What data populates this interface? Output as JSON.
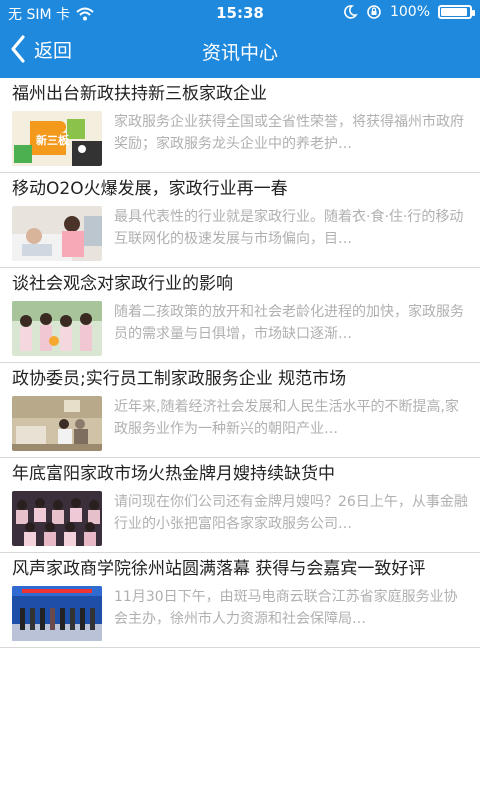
{
  "status_bar": {
    "carrier": "无 SIM 卡",
    "time": "15:38",
    "battery_text": "100%",
    "battery_level": 1.0
  },
  "nav": {
    "back_label": "返回",
    "title": "资讯中心",
    "icons": [
      "chevron-left-icon"
    ]
  },
  "colors": {
    "accent": "#1e89dd",
    "headline": "#222222",
    "summary": "#b0b0b0",
    "divider": "#d8d8d8"
  },
  "news": [
    {
      "headline": "福州出台新政扶持新三板家政企业",
      "summary": "家政服务企业获得全国或全省性荣誉，将获得福州市政府奖励；家政服务龙头企业中的养老护…",
      "thumb_text": "新三板"
    },
    {
      "headline": "移动O2O火爆发展，家政行业再一春",
      "summary": "最具代表性的行业就是家政行业。随着衣·食·住·行的移动互联网化的极速发展与市场偏向，目…"
    },
    {
      "headline": "谈社会观念对家政行业的影响",
      "summary": "随着二孩政策的放开和社会老龄化进程的加快，家政服务员的需求量与日俱增，市场缺口逐渐…"
    },
    {
      "headline": "政协委员;实行员工制家政服务企业 规范市场",
      "summary": "近年来,随着经济社会发展和人民生活水平的不断提高,家政服务业作为一种新兴的朝阳产业…"
    },
    {
      "headline": "年底富阳家政市场火热金牌月嫂持续缺货中",
      "summary": "请问现在你们公司还有金牌月嫂吗？26日上午，从事金融行业的小张把富阳各家家政服务公司…"
    },
    {
      "headline": "风声家政商学院徐州站圆满落幕 获得与会嘉宾一致好评",
      "summary": "11月30日下午，由斑马电商云联合江苏省家庭服务业协会主办，徐州市人力资源和社会保障局…"
    }
  ]
}
